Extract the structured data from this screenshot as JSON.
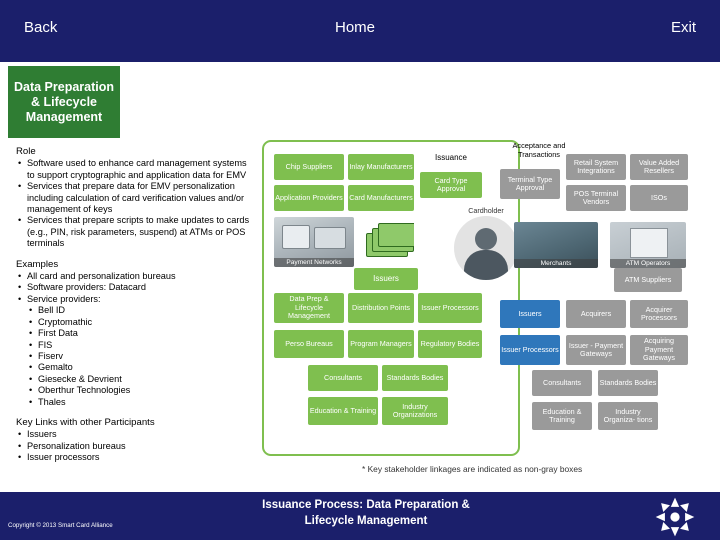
{
  "topbar": {
    "back": "Back",
    "home": "Home",
    "exit": "Exit"
  },
  "title_tab": "Data Preparation & Lifecycle Management",
  "left": {
    "role_heading": "Role",
    "role_items": [
      "Software used to enhance card management systems to support cryptographic and application data for EMV",
      "Services that prepare data for EMV personalization including calculation of card verification values and/or management of keys",
      "Services that prepare scripts to make updates to cards (e.g., PIN, risk parameters, suspend) at ATMs or POS terminals"
    ],
    "examples_heading": "Examples",
    "examples_items": [
      "All card and personalization bureaus",
      "Software providers: Datacard",
      "Service providers:"
    ],
    "providers": [
      "Bell ID",
      "Cryptomathic",
      "First Data",
      "FIS",
      "Fiserv",
      "Gemalto",
      "Giesecke & Devrient",
      "Oberthur Technologies",
      "Thales"
    ],
    "links_heading": "Key Links with other Participants",
    "links_items": [
      "Issuers",
      "Personalization bureaus",
      "Issuer processors"
    ]
  },
  "diagram": {
    "green_boxes": [
      "Chip Suppliers",
      "Inlay Manufacturers",
      "Application Providers",
      "Card Manufacturers",
      "Issuance",
      "Card Type Approval",
      "Issuers",
      "Data Prep & Lifecycle Management",
      "Distribution Points",
      "Issuer Processors",
      "Perso Bureaus",
      "Program Managers",
      "Regulatory Bodies",
      "Consultants",
      "Standards Bodies",
      "Education & Training",
      "Industry Organizations"
    ],
    "photo_captions": {
      "payment_networks": "Payment Networks",
      "issuers": "Issuers",
      "merchants": "Merchants",
      "atm": "ATM Operators"
    },
    "cardholder_label": "Cardholder",
    "acceptance_heading": "Acceptance and Transactions",
    "right_boxes": [
      "Retail System Integrations",
      "Value Added Resellers",
      "Terminal Type Approval",
      "POS Terminal Vendors",
      "ISOs",
      "Payment Networks",
      "ATM Suppliers",
      "Issuers",
      "Acquirers",
      "Acquirer Processors",
      "Issuer Processors",
      "Issuer - Payment Gateways",
      "Acquiring Payment Gateways",
      "Consultants",
      "Standards Bodies",
      "Education & Training",
      "Industry Organiza- tions"
    ],
    "footnote": "* Key stakeholder linkages are indicated as non-gray boxes"
  },
  "bottom": {
    "copyright": "Copyright © 2013 Smart Card Alliance",
    "title_line1": "Issuance Process:  Data Preparation &",
    "title_line2": "Lifecycle Management"
  }
}
